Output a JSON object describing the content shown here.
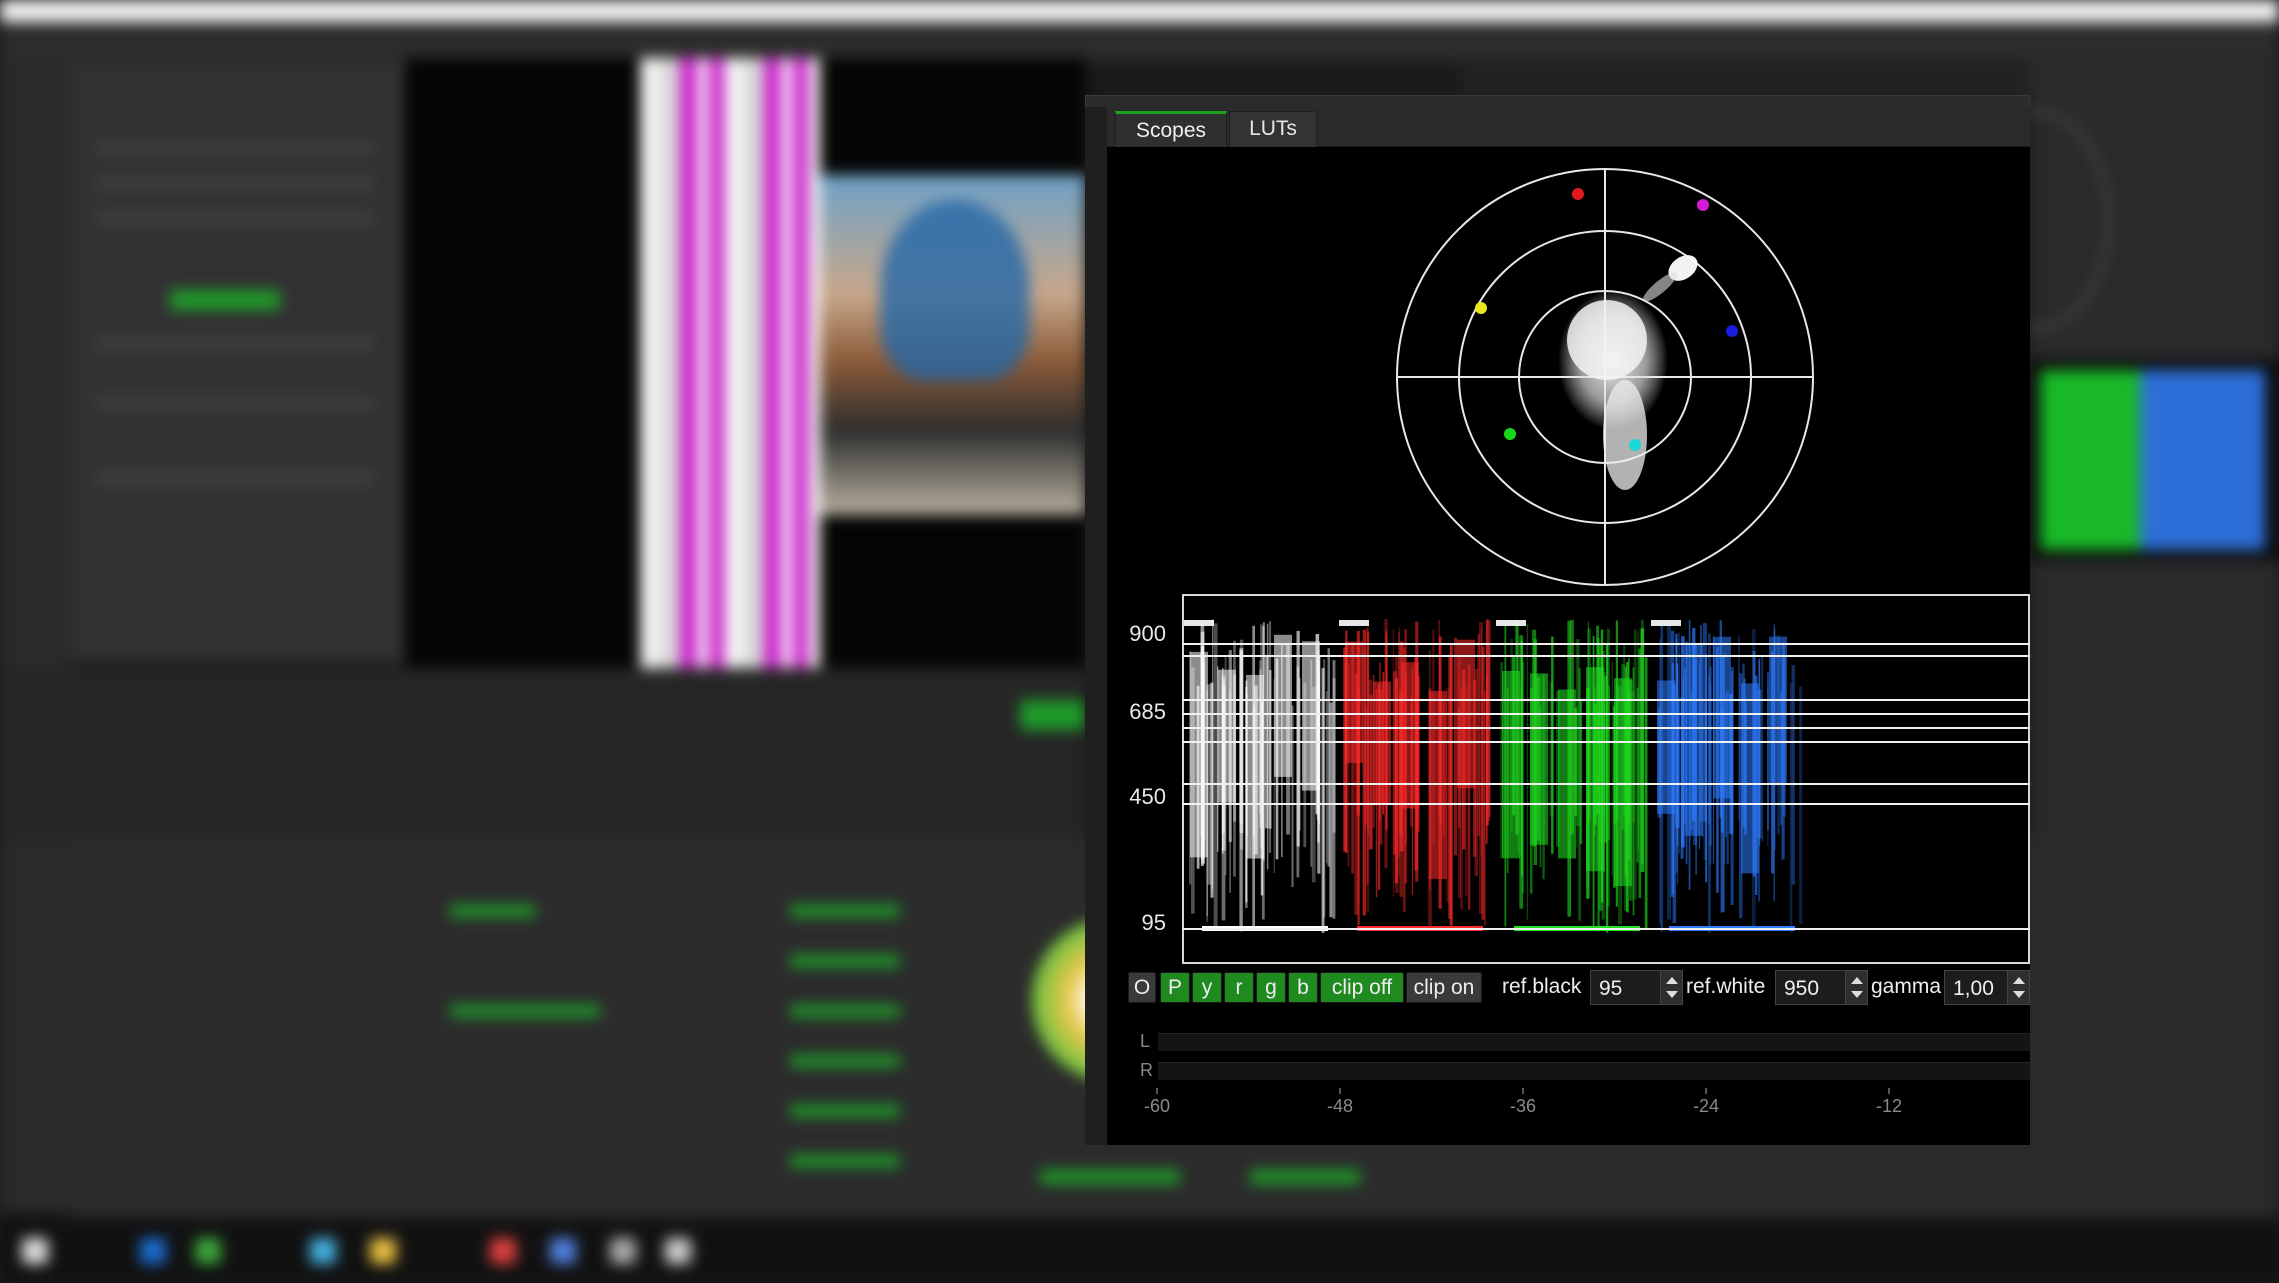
{
  "scopes_window": {
    "tabs": [
      {
        "label": "Scopes",
        "active": true
      },
      {
        "label": "LUTs",
        "active": false
      }
    ]
  },
  "vectorscope": {
    "targets": [
      {
        "name": "red",
        "color": "#e01a1a"
      },
      {
        "name": "magenta",
        "color": "#d61ad6"
      },
      {
        "name": "yellow",
        "color": "#e8e81a"
      },
      {
        "name": "blue",
        "color": "#1a1ae0"
      },
      {
        "name": "green",
        "color": "#1ad61a"
      },
      {
        "name": "cyan",
        "color": "#1ad6d6"
      }
    ]
  },
  "waveform": {
    "levels": [
      "900",
      "685",
      "450",
      "95"
    ],
    "channels": [
      {
        "name": "luma",
        "color": "#ffffff"
      },
      {
        "name": "red",
        "color": "#ff2a2a"
      },
      {
        "name": "green",
        "color": "#20e020"
      },
      {
        "name": "blue",
        "color": "#2e7bff"
      }
    ]
  },
  "controls": {
    "buttons": [
      {
        "label": "O",
        "on": false
      },
      {
        "label": "P",
        "on": true
      },
      {
        "label": "y",
        "on": true
      },
      {
        "label": "r",
        "on": true
      },
      {
        "label": "g",
        "on": true
      },
      {
        "label": "b",
        "on": true
      },
      {
        "label": "clip off",
        "on": true
      },
      {
        "label": "clip on",
        "on": false
      }
    ],
    "ref_black_label": "ref.black",
    "ref_black_value": "95",
    "ref_white_label": "ref.white",
    "ref_white_value": "950",
    "gamma_label": "gamma",
    "gamma_value": "1,00"
  },
  "audio_meter": {
    "channels": [
      "L",
      "R"
    ],
    "scale": [
      "-60",
      "-48",
      "-36",
      "-24",
      "-12"
    ]
  },
  "colors": {
    "accent": "#1da11d",
    "window_bg": "#2b2b2b"
  }
}
